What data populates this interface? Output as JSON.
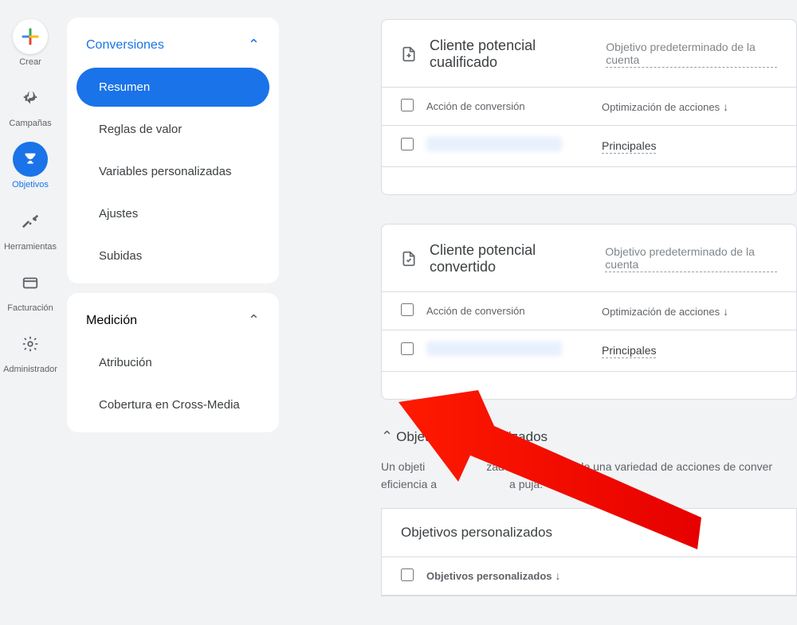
{
  "rail": {
    "items": [
      {
        "label": "Crear",
        "icon": "plus-icon"
      },
      {
        "label": "Campañas",
        "icon": "megaphone-icon"
      },
      {
        "label": "Objetivos",
        "icon": "trophy-icon",
        "active": true
      },
      {
        "label": "Herramientas",
        "icon": "tools-icon"
      },
      {
        "label": "Facturación",
        "icon": "card-icon"
      },
      {
        "label": "Administrador",
        "icon": "gear-icon"
      }
    ]
  },
  "sidebar": {
    "groups": [
      {
        "title": "Conversiones",
        "collapsed": false,
        "color": "blue",
        "items": [
          {
            "label": "Resumen",
            "active": true
          },
          {
            "label": "Reglas de valor"
          },
          {
            "label": "Variables personalizadas"
          },
          {
            "label": "Ajustes"
          },
          {
            "label": "Subidas"
          }
        ]
      },
      {
        "title": "Medición",
        "collapsed": false,
        "items": [
          {
            "label": "Atribución"
          },
          {
            "label": "Cobertura en Cross-Media"
          }
        ]
      }
    ]
  },
  "main": {
    "cards": [
      {
        "icon": "document-plus-icon",
        "title": "Cliente potencial cualificado",
        "subtitle": "Objetivo predeterminado de la cuenta",
        "columns": {
          "action": "Acción de conversión",
          "opt": "Optimización de acciones"
        },
        "rows": [
          {
            "opt": "Principales"
          }
        ]
      },
      {
        "icon": "document-check-icon",
        "title": "Cliente potencial convertido",
        "subtitle": "Objetivo predeterminado de la cuenta",
        "columns": {
          "action": "Acción de conversión",
          "opt": "Optimización de acciones"
        },
        "rows": [
          {
            "opt": "Principales"
          }
        ]
      }
    ],
    "custom_section": {
      "title": "Objetivos personalizados",
      "description_parts": {
        "pre": "Un objeti",
        "mid": "zado se compone de una variedad de acciones de conver",
        "post": "eficiencia a",
        "tail": "a puja."
      },
      "table_title": "Objetivos personalizados",
      "column": "Objetivos personalizados"
    }
  }
}
